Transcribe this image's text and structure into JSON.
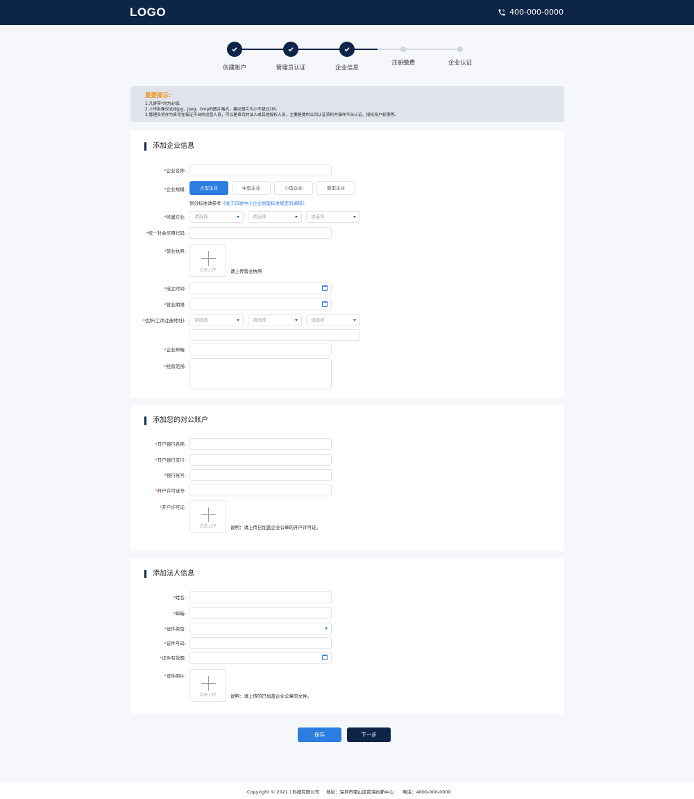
{
  "header": {
    "logo": "LOGO",
    "phone": "400-000-0000",
    "bg_color": "#0d2547"
  },
  "steps": [
    {
      "label": "创建账户",
      "status": "done"
    },
    {
      "label": "管理员认证",
      "status": "done"
    },
    {
      "label": "企业信息",
      "status": "done"
    },
    {
      "label": "注册缴费",
      "status": "pending"
    },
    {
      "label": "企业认证",
      "status": "pending"
    }
  ],
  "notice": {
    "title": "重要提示:",
    "lines": [
      "1.凡是带*均为必填。",
      "2.上传影像仅支持jpg、jpeg、bmp的图片格式，建议图片大小不超过2M。",
      "3.管理员将作为贵司在临证平台的运营人员，可以是贵司的法人或其他授权人员，主要是提供公司认证资料并操作平台认证、授权用户权限等。"
    ]
  },
  "company": {
    "title": "添加企业信息",
    "name_label": "企业名称:",
    "scale_label": "企业规模:",
    "scale_options": [
      "大型企业",
      "中型企业",
      "小型企业",
      "微型企业"
    ],
    "scale_selected": "大型企业",
    "scale_hint": "划分标准请参考",
    "scale_link": "《关于印发中小企业划型标准规定的通知》",
    "industry_label": "所属行业:",
    "select_placeholder": "请选择",
    "credit_label": "统一社会信用代码:",
    "license_label": "营业执照:",
    "upload_text": "点击上传",
    "license_note": "请上传营业执照",
    "founded_label": "成立时间:",
    "term_label": "营业期限:",
    "address_label": "住所(工商注册地址):",
    "email_label": "企业邮箱:",
    "scope_label": "经营范围:"
  },
  "bank": {
    "title": "添加您的对公账户",
    "bank_name_label": "开户银行名称:",
    "branch_label": "开户银行支行:",
    "account_label": "银行账号:",
    "permit_no_label": "开户许可证号:",
    "permit_label": "开户许可证:",
    "upload_text": "点击上传",
    "permit_note": "说明：请上传已加盖企业公章的开户许可证。"
  },
  "legal": {
    "title": "添加法人信息",
    "name_label": "姓名:",
    "email_label": "邮箱:",
    "id_type_label": "证件类型:",
    "id_no_label": "证件号码:",
    "id_valid_label": "证件有效期:",
    "id_photo_label": "证件照片:",
    "upload_text": "点击上传",
    "photo_note": "说明：请上传的已加盖企业公章的文件。"
  },
  "actions": {
    "save": "保存",
    "next": "下一步"
  },
  "footer": {
    "copyright": "Copyright © 2021 | 科技有限公司",
    "address": "地址：深圳市南山区前海创新中心",
    "phone": "电话：4000-000-0000"
  }
}
